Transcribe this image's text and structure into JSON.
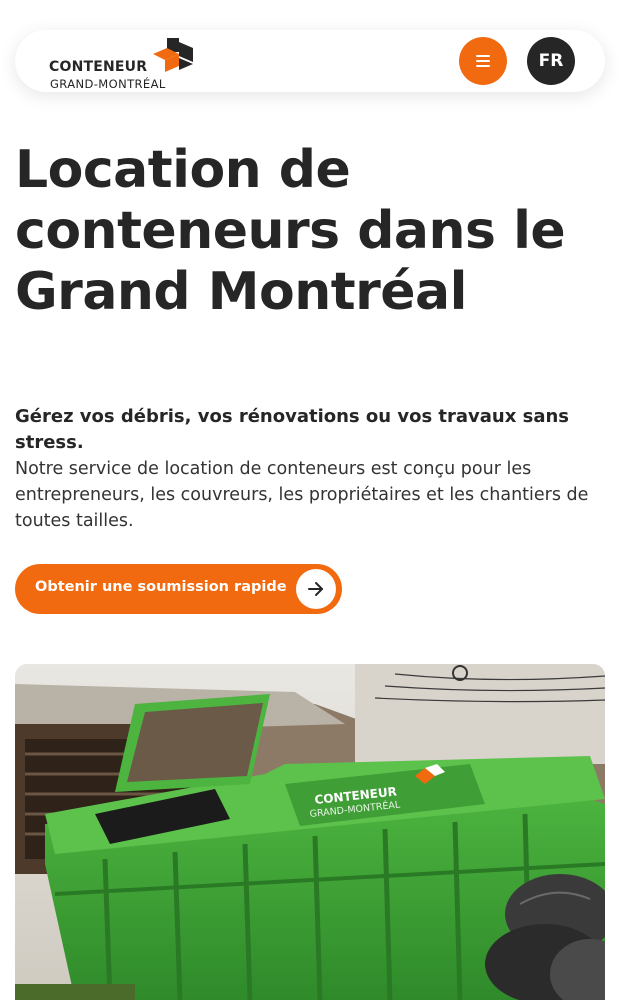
{
  "header": {
    "logo": {
      "word1": "CONTENEUR",
      "word2": "GRAND-MONTRÉAL"
    },
    "menu_icon": "hamburger-icon",
    "language_label": "FR"
  },
  "hero": {
    "title": "Location de conteneurs dans le Grand Montréal",
    "lead": "Gérez vos débris, vos rénovations ou vos travaux sans stress.",
    "body": "Notre service de location de conteneurs est conçu pour les entrepreneurs, les couvreurs, les propriétaires et les chantiers de toutes tailles.",
    "cta_label": "Obtenir une soumission rapide",
    "cta_icon": "arrow-right-icon"
  },
  "photo": {
    "sign_word1": "CONTENEUR",
    "sign_word2": "GRAND-MONTRÉAL"
  },
  "colors": {
    "accent": "#f26a0f",
    "dark": "#262626",
    "container_green": "#3fa535"
  }
}
